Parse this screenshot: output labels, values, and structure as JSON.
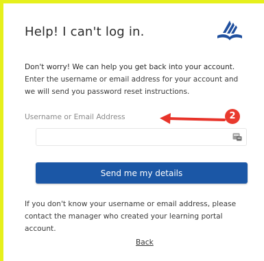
{
  "page": {
    "title": "Help! I can't log in.",
    "intro": {
      "lead": "Don't worry! We can help you get back into your account.",
      "rest": "Enter the username or email address for your account and we will send you password reset instructions."
    },
    "field": {
      "label": "Username or Email Address",
      "value": "",
      "placeholder": ""
    },
    "send_button": "Send me my details",
    "help_text": "If you don't know your username or email address, please contact the manager who created your learning portal account.",
    "back_link": "Back"
  },
  "annotation": {
    "badge_number": "2",
    "badge_color": "#e93a2e",
    "arrow_color": "#e8342a"
  },
  "colors": {
    "frame": "#e6f01c",
    "primary": "#1b57a6",
    "logo": "#1f4f9e"
  },
  "icons": {
    "logo": "church-logo-icon",
    "input_icon": "password-manager-icon"
  }
}
